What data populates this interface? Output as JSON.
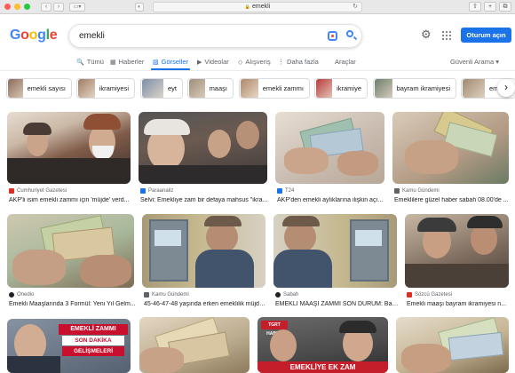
{
  "browser": {
    "address": "emekli",
    "lock": "🔒"
  },
  "logo": [
    "G",
    "o",
    "o",
    "g",
    "l",
    "e"
  ],
  "logo_colors": [
    "#4285f4",
    "#ea4335",
    "#fbbc05",
    "#4285f4",
    "#34a853",
    "#ea4335"
  ],
  "search": {
    "query": "emekli"
  },
  "header": {
    "signin_label": "Oturum açın"
  },
  "tabs": [
    {
      "label": "Tümü",
      "icon": "search-icon",
      "glyph": "🔍",
      "active": false
    },
    {
      "label": "Haberler",
      "icon": "news-icon",
      "glyph": "▦",
      "active": false
    },
    {
      "label": "Görseller",
      "icon": "images-icon",
      "glyph": "▨",
      "active": true
    },
    {
      "label": "Videolar",
      "icon": "video-icon",
      "glyph": "▶",
      "active": false
    },
    {
      "label": "Alışveriş",
      "icon": "tag-icon",
      "glyph": "◇",
      "active": false
    },
    {
      "label": "Daha fazla",
      "icon": "more-icon",
      "glyph": "⋮",
      "active": false
    },
    {
      "label": "Araçlar",
      "icon": "",
      "glyph": "",
      "active": false
    }
  ],
  "safe_search": "Güvenli Arama ▾",
  "chips": [
    {
      "label": "emekli sayısı",
      "color": "#8b6b5a"
    },
    {
      "label": "ikramiyesi",
      "color": "#a07c62"
    },
    {
      "label": "eyt",
      "color": "#7d8fa8"
    },
    {
      "label": "maaşı",
      "color": "#9e8e7a"
    },
    {
      "label": "emekli zammı",
      "color": "#b0876a"
    },
    {
      "label": "ikramiye",
      "color": "#b73b3b"
    },
    {
      "label": "bayram ikramiyesi",
      "color": "#6e7d6a"
    },
    {
      "label": "emekli",
      "color": "#a28a72"
    }
  ],
  "results": [
    {
      "source": "Cumhuriyet Gazetesi",
      "title": "AKP'li isim emekli zammı için 'müjde' verd...",
      "fav": "#d93025",
      "img": [
        "#7f5b49",
        "#cfc4b6",
        "#4a3b34"
      ]
    },
    {
      "source": "Paraanaliz",
      "title": "Selvi: Emekliye zam bir defaya mahsus \"ikra...",
      "fav": "#1a73e8",
      "img": [
        "#6b5a50",
        "#d8d2cc",
        "#3d3a3b"
      ]
    },
    {
      "source": "T24",
      "title": "AKP'den emekli aylıklarına ilişkin açı...",
      "fav": "#1a73e8",
      "img": [
        "#c7b9ad",
        "#9bb0a3",
        "#5c6f66"
      ]
    },
    {
      "source": "Kamu Gündemi",
      "title": "Emeklilere güzel haber sabah 08.00'de ...",
      "fav": "#5f6368",
      "img": [
        "#b29a84",
        "#d9cbb9",
        "#6b7a63"
      ]
    },
    {
      "source": "Onedio",
      "title": "Emekli Maaşlarında 3 Formül: Yeni Yıl Gelm...",
      "fav": "#202124",
      "img": [
        "#a8b89b",
        "#cfc8b0",
        "#7e6b55"
      ]
    },
    {
      "source": "Kamu Gündemi",
      "title": "45-46-47-48 yaşında erken emeklilik müjde...",
      "fav": "#5f6368",
      "img": [
        "#a89a78",
        "#5f6f7c",
        "#d7d1c3"
      ]
    },
    {
      "source": "Sabah",
      "title": "EMEKLİ MAAŞI ZAMMI SON DURUM: Bak...",
      "fav": "#202124",
      "img": [
        "#a89a78",
        "#5f6f7c",
        "#d7d1c3"
      ]
    },
    {
      "source": "Sözcü Gazetesi",
      "title": "Emekli maaşı bayram ikramiyesi n...",
      "fav": "#d93025",
      "img": [
        "#7b6a5c",
        "#c8b7a3",
        "#4b4038"
      ]
    }
  ],
  "row3": [
    {
      "img": [
        "#556070",
        "#d6cfc8",
        "#8a2a2a"
      ],
      "banner": [
        "EMEKLİ ZAMMI",
        "SON DAKİKA",
        "GELİŞMELERİ"
      ]
    },
    {
      "img": [
        "#d6c9b4",
        "#b9a98c",
        "#8e7a5d"
      ]
    },
    {
      "img": [
        "#4a4a4a",
        "#c41e2b",
        "#2d2d2d"
      ],
      "tag": "TGRT HABER",
      "banner2": "EMEKLİYE EK ZAM"
    },
    {
      "img": [
        "#c7b594",
        "#e4dccb",
        "#7b6a4e"
      ]
    }
  ]
}
